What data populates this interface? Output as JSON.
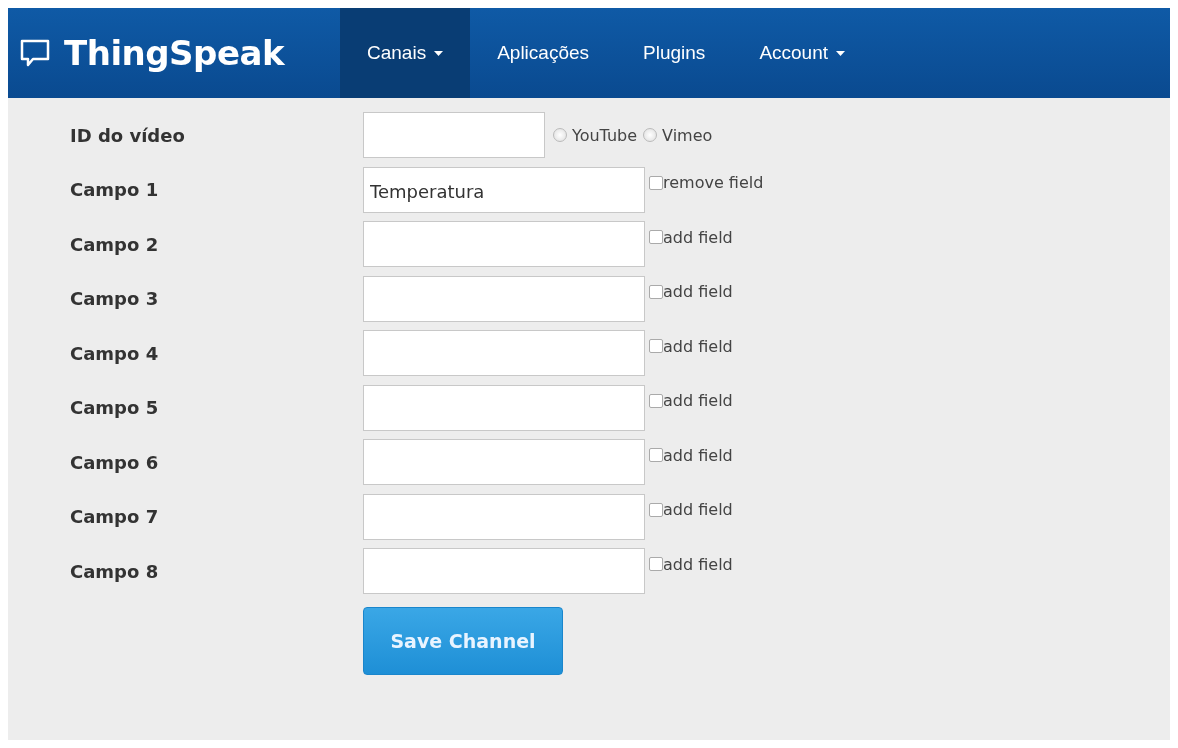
{
  "brand": {
    "name": "ThingSpeak"
  },
  "nav": [
    {
      "label": "Canais",
      "selected": true,
      "has_menu": true
    },
    {
      "label": "Aplicações",
      "selected": false,
      "has_menu": false
    },
    {
      "label": "Plugins",
      "selected": false,
      "has_menu": false
    },
    {
      "label": "Account",
      "selected": false,
      "has_menu": true
    }
  ],
  "video": {
    "label": "ID do vídeo",
    "options": [
      {
        "label": "YouTube",
        "selected": false
      },
      {
        "label": "Vimeo",
        "selected": false
      }
    ]
  },
  "fields": [
    {
      "label": "Campo 1",
      "value": "Temperatura",
      "checked": false,
      "action": "remove field"
    },
    {
      "label": "Campo 2",
      "checked": false,
      "action": "add field"
    },
    {
      "label": "Campo 3",
      "checked": false,
      "action": "add field"
    },
    {
      "label": "Campo 4",
      "checked": false,
      "action": "add field"
    },
    {
      "label": "Campo 5",
      "checked": false,
      "action": "add field"
    },
    {
      "label": "Campo 6",
      "checked": false,
      "action": "add field"
    },
    {
      "label": "Campo 7",
      "checked": false,
      "action": "add field"
    },
    {
      "label": "Campo 8",
      "checked": false,
      "action": "add field"
    }
  ],
  "save_button": "Save Channel"
}
